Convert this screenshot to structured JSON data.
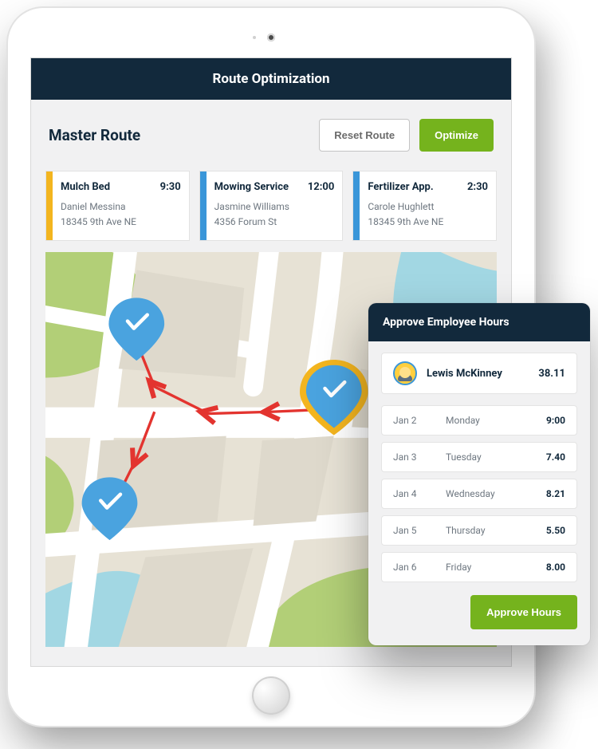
{
  "header": {
    "title": "Route Optimization"
  },
  "route": {
    "title": "Master Route",
    "reset_label": "Reset Route",
    "optimize_label": "Optimize"
  },
  "stops": [
    {
      "name": "Mulch Bed",
      "time": "9:30",
      "person": "Daniel Messina",
      "address": "18345 9th Ave NE",
      "color": "yellow"
    },
    {
      "name": "Mowing Service",
      "time": "12:00",
      "person": "Jasmine Williams",
      "address": "4356 Forum St",
      "color": "blue"
    },
    {
      "name": "Fertilizer App.",
      "time": "2:30",
      "person": "Carole Hughlett",
      "address": "18345 9th Ave NE",
      "color": "blue"
    }
  ],
  "hours": {
    "title": "Approve Employee Hours",
    "employee_name": "Lewis McKinney",
    "total": "38.11",
    "days": [
      {
        "date": "Jan 2",
        "day": "Monday",
        "hours": "9:00"
      },
      {
        "date": "Jan 3",
        "day": "Tuesday",
        "hours": "7.40"
      },
      {
        "date": "Jan 4",
        "day": "Wednesday",
        "hours": "8.21"
      },
      {
        "date": "Jan 5",
        "day": "Thursday",
        "hours": "5.50"
      },
      {
        "date": "Jan 6",
        "day": "Friday",
        "hours": "8.00"
      }
    ],
    "approve_label": "Approve Hours"
  },
  "colors": {
    "navy": "#12293c",
    "green": "#75b31d",
    "blue": "#3a96d9",
    "yellow": "#f3b51f"
  }
}
